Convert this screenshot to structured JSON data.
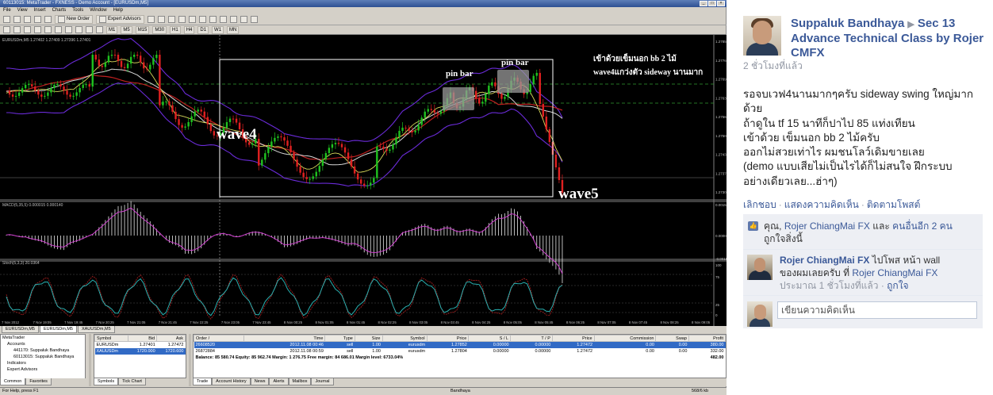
{
  "mt": {
    "title": "60113015: MetaTrader - FXNESS - Demo Account - [EURUSDm,M5]",
    "menu": [
      "File",
      "View",
      "Insert",
      "Charts",
      "Tools",
      "Window",
      "Help"
    ],
    "toolbar": {
      "new_order": "New Order",
      "expert_advisors": "Expert Advisors"
    },
    "timeframes": [
      "M1",
      "M5",
      "M15",
      "M30",
      "H1",
      "H4",
      "D1",
      "W1",
      "MN"
    ],
    "chart": {
      "header": "EURUSDm,M5  1.27402  1.27409  1.27396  1.27401",
      "annotations": {
        "wave4": "wave4",
        "wave5": "wave5",
        "pinbar1": "pin bar",
        "pinbar2": "pin bar",
        "note1": "เข้าด้วยเข็มนอก bb 2 ไม้",
        "note2": "wave4แกว่งตัว sideway นานมาก"
      },
      "macd_label": "MACD(5,35,5) 0.000015 0.000140",
      "stoch_label": "Stoch(5,3,3) 20.0364",
      "price_ticks": [
        "1.27850",
        "1.27760",
        "1.27695",
        "1.27630",
        "1.27565",
        "1.27500",
        "1.27435",
        "1.27370",
        "1.27305"
      ],
      "macd_ticks": [
        "0.00154",
        "0.00000",
        "-0.00157"
      ],
      "stoch_ticks": [
        "100",
        "75",
        "25",
        "0"
      ],
      "time_ticks": [
        "7 Nov 2012",
        "7 Nov 19:05",
        "7 Nov 19:45",
        "7 Nov 20:25",
        "7 Nov 21:05",
        "7 Nov 21:45",
        "7 Nov 22:25",
        "7 Nov 23:05",
        "7 Nov 23:45",
        "8 Nov 00:25",
        "8 Nov 01:05",
        "8 Nov 01:45",
        "8 Nov 02:25",
        "8 Nov 03:05",
        "8 Nov 03:45",
        "8 Nov 04:25",
        "8 Nov 05:05",
        "8 Nov 05:45",
        "8 Nov 06:25",
        "8 Nov 07:05",
        "8 Nov 07:45",
        "8 Nov 08:25",
        "8 Nov 09:05"
      ]
    },
    "chart_tabs": [
      "EURUSDm,M5",
      "EURUSDm,M5",
      "XAUUSDm,M5"
    ],
    "navigator": {
      "items": [
        "MetaTrader",
        "Accounts",
        "441170: Suppaluk Bandhaya",
        "60113015: Suppaluk Bandhaya",
        "Indicators",
        "Expert Advisors"
      ],
      "tabs": [
        "Common",
        "Favorites"
      ]
    },
    "watch": {
      "headers": [
        "Symbol",
        "Bid",
        "Ask"
      ],
      "rows": [
        {
          "symbol": "EURUSDm",
          "bid": "1.27401",
          "ask": "1.27472"
        },
        {
          "symbol": "XAUUSDm",
          "bid": "1720.000",
          "ask": "1720.600"
        }
      ],
      "tabs": [
        "Symbols",
        "Tick Chart"
      ]
    },
    "terminal": {
      "headers": [
        "Order /",
        "Time",
        "Type",
        "Size",
        "Symbol",
        "Price",
        "S / L",
        "T / P",
        "Price",
        "Commission",
        "Swap",
        "Profit"
      ],
      "rows": [
        [
          "26608520",
          "2012.11.08 00:46",
          "sell",
          "1.00",
          "eurusdm",
          "1.27852",
          "0.00000",
          "0.00000",
          "1.27472",
          "0.00",
          "0.00",
          "380.00"
        ],
        [
          "26872884",
          "2012.11.08 00:59",
          "sell",
          "1.00",
          "eurusdm",
          "1.27804",
          "0.00000",
          "0.00000",
          "1.27472",
          "0.00",
          "0.00",
          "332.00"
        ]
      ],
      "balance_line": "Balance: 85 580.74  Equity: 85 962.74  Margin: 1 276.75  Free margin: 84 686.01  Margin level: 6733.04%",
      "balance_total": "482.00",
      "tabs": [
        "Trade",
        "Account History",
        "News",
        "Alerts",
        "Mailbox",
        "Journal"
      ]
    },
    "status": {
      "help": "For Help, press F1",
      "user": "Bandhaya",
      "traffic": "568/6 kb"
    }
  },
  "fb": {
    "author": "Suppaluk Bandhaya",
    "arrow": "▶",
    "group": "Sec 13 Advance Technical Class by Rojer CMFX",
    "time": "2 ชั่วโมงที่แล้ว",
    "body": [
      "รอจบเวฟ4นานมากๆครับ sideway swing ใหญ่มาก",
      "ด้วย",
      "ถ้าดูใน tf 15 นาทีก็ปาไป 85 แท่งเทียน",
      "เข้าด้วย เข็มนอก bb 2 ไม้ครับ",
      "ออกไม่สวยเท่าไร ผมชนโลว์เดิมขายเลย",
      "(demo แบบเสียไม่เป็นไรได้ก็ไม่สนใจ ฝึกระบบ",
      "อย่างเดียวเลย...ฮ่าๆ)"
    ],
    "actions": {
      "unlike": "เลิกชอบ",
      "comment": "แสดงความคิดเห็น",
      "follow": "ติดตามโพสต์",
      "sep": "·"
    },
    "likes": {
      "you": "คุณ,",
      "name": "Rojer ChiangMai FX",
      "and": "และ",
      "others": "คนอื่นอีก 2 คน",
      "suffix": "ถูกใจสิ่งนี้"
    },
    "comment": {
      "author": "Rojer ChiangMai FX",
      "text1": "ไปโพส หน้า wall",
      "text2": "ของผมเลยครับ ที่",
      "link": "Rojer ChiangMai FX",
      "time": "ประมาณ 1 ชั่วโมงที่แล้ว",
      "sep": "·",
      "like": "ถูกใจ"
    },
    "write_placeholder": "เขียนความคิดเห็น"
  }
}
